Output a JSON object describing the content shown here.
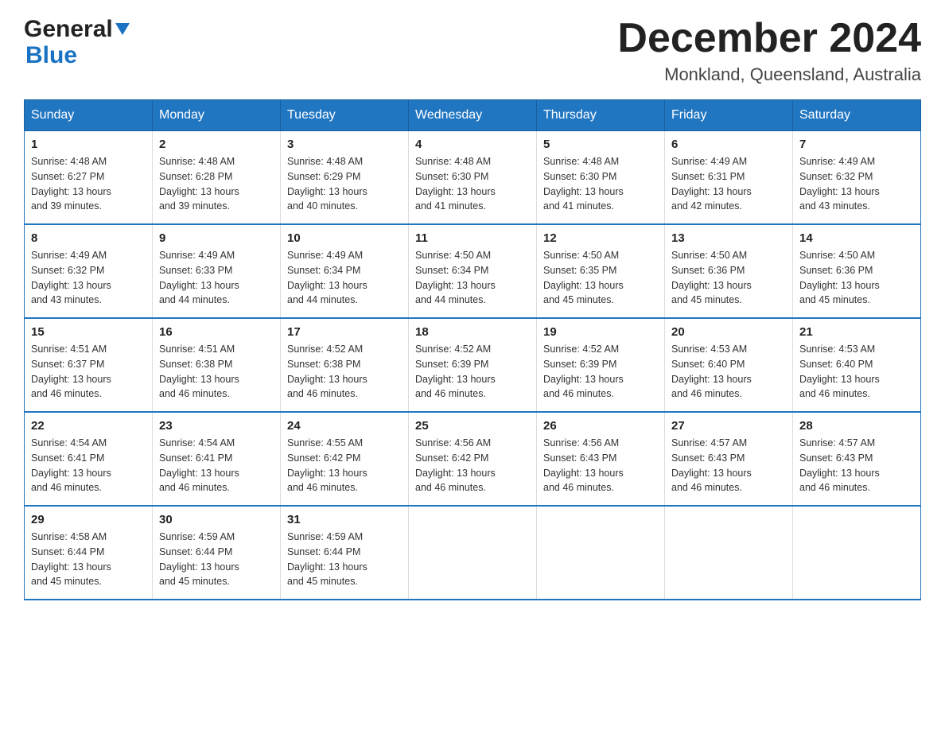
{
  "header": {
    "logo_general": "General",
    "logo_blue": "Blue",
    "title": "December 2024",
    "subtitle": "Monkland, Queensland, Australia"
  },
  "weekdays": [
    "Sunday",
    "Monday",
    "Tuesday",
    "Wednesday",
    "Thursday",
    "Friday",
    "Saturday"
  ],
  "weeks": [
    [
      {
        "day": "1",
        "sunrise": "4:48 AM",
        "sunset": "6:27 PM",
        "daylight": "13 hours and 39 minutes."
      },
      {
        "day": "2",
        "sunrise": "4:48 AM",
        "sunset": "6:28 PM",
        "daylight": "13 hours and 39 minutes."
      },
      {
        "day": "3",
        "sunrise": "4:48 AM",
        "sunset": "6:29 PM",
        "daylight": "13 hours and 40 minutes."
      },
      {
        "day": "4",
        "sunrise": "4:48 AM",
        "sunset": "6:30 PM",
        "daylight": "13 hours and 41 minutes."
      },
      {
        "day": "5",
        "sunrise": "4:48 AM",
        "sunset": "6:30 PM",
        "daylight": "13 hours and 41 minutes."
      },
      {
        "day": "6",
        "sunrise": "4:49 AM",
        "sunset": "6:31 PM",
        "daylight": "13 hours and 42 minutes."
      },
      {
        "day": "7",
        "sunrise": "4:49 AM",
        "sunset": "6:32 PM",
        "daylight": "13 hours and 43 minutes."
      }
    ],
    [
      {
        "day": "8",
        "sunrise": "4:49 AM",
        "sunset": "6:32 PM",
        "daylight": "13 hours and 43 minutes."
      },
      {
        "day": "9",
        "sunrise": "4:49 AM",
        "sunset": "6:33 PM",
        "daylight": "13 hours and 44 minutes."
      },
      {
        "day": "10",
        "sunrise": "4:49 AM",
        "sunset": "6:34 PM",
        "daylight": "13 hours and 44 minutes."
      },
      {
        "day": "11",
        "sunrise": "4:50 AM",
        "sunset": "6:34 PM",
        "daylight": "13 hours and 44 minutes."
      },
      {
        "day": "12",
        "sunrise": "4:50 AM",
        "sunset": "6:35 PM",
        "daylight": "13 hours and 45 minutes."
      },
      {
        "day": "13",
        "sunrise": "4:50 AM",
        "sunset": "6:36 PM",
        "daylight": "13 hours and 45 minutes."
      },
      {
        "day": "14",
        "sunrise": "4:50 AM",
        "sunset": "6:36 PM",
        "daylight": "13 hours and 45 minutes."
      }
    ],
    [
      {
        "day": "15",
        "sunrise": "4:51 AM",
        "sunset": "6:37 PM",
        "daylight": "13 hours and 46 minutes."
      },
      {
        "day": "16",
        "sunrise": "4:51 AM",
        "sunset": "6:38 PM",
        "daylight": "13 hours and 46 minutes."
      },
      {
        "day": "17",
        "sunrise": "4:52 AM",
        "sunset": "6:38 PM",
        "daylight": "13 hours and 46 minutes."
      },
      {
        "day": "18",
        "sunrise": "4:52 AM",
        "sunset": "6:39 PM",
        "daylight": "13 hours and 46 minutes."
      },
      {
        "day": "19",
        "sunrise": "4:52 AM",
        "sunset": "6:39 PM",
        "daylight": "13 hours and 46 minutes."
      },
      {
        "day": "20",
        "sunrise": "4:53 AM",
        "sunset": "6:40 PM",
        "daylight": "13 hours and 46 minutes."
      },
      {
        "day": "21",
        "sunrise": "4:53 AM",
        "sunset": "6:40 PM",
        "daylight": "13 hours and 46 minutes."
      }
    ],
    [
      {
        "day": "22",
        "sunrise": "4:54 AM",
        "sunset": "6:41 PM",
        "daylight": "13 hours and 46 minutes."
      },
      {
        "day": "23",
        "sunrise": "4:54 AM",
        "sunset": "6:41 PM",
        "daylight": "13 hours and 46 minutes."
      },
      {
        "day": "24",
        "sunrise": "4:55 AM",
        "sunset": "6:42 PM",
        "daylight": "13 hours and 46 minutes."
      },
      {
        "day": "25",
        "sunrise": "4:56 AM",
        "sunset": "6:42 PM",
        "daylight": "13 hours and 46 minutes."
      },
      {
        "day": "26",
        "sunrise": "4:56 AM",
        "sunset": "6:43 PM",
        "daylight": "13 hours and 46 minutes."
      },
      {
        "day": "27",
        "sunrise": "4:57 AM",
        "sunset": "6:43 PM",
        "daylight": "13 hours and 46 minutes."
      },
      {
        "day": "28",
        "sunrise": "4:57 AM",
        "sunset": "6:43 PM",
        "daylight": "13 hours and 46 minutes."
      }
    ],
    [
      {
        "day": "29",
        "sunrise": "4:58 AM",
        "sunset": "6:44 PM",
        "daylight": "13 hours and 45 minutes."
      },
      {
        "day": "30",
        "sunrise": "4:59 AM",
        "sunset": "6:44 PM",
        "daylight": "13 hours and 45 minutes."
      },
      {
        "day": "31",
        "sunrise": "4:59 AM",
        "sunset": "6:44 PM",
        "daylight": "13 hours and 45 minutes."
      },
      null,
      null,
      null,
      null
    ]
  ],
  "labels": {
    "sunrise": "Sunrise:",
    "sunset": "Sunset:",
    "daylight": "Daylight:"
  }
}
